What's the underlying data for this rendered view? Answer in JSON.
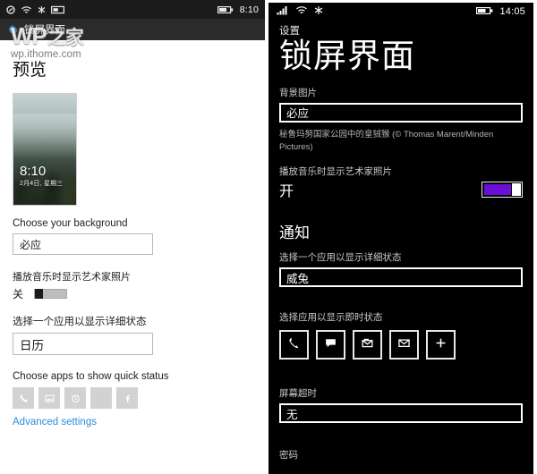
{
  "left": {
    "statusbar": {
      "icons": [
        "signal-icon",
        "wifi-icon",
        "bluetooth-icon",
        "sim-icon"
      ],
      "battery_icon": "battery-icon",
      "time": "8:10"
    },
    "appbar": {
      "gear_icon": "gear-icon",
      "title": "锁屏界面"
    },
    "watermark": {
      "big": "WP",
      "big_cn": "之家",
      "sub": "wp.ithome.com"
    },
    "preview_heading": "预览",
    "thumbnail": {
      "time": "8:10",
      "date": "2月4日, 星期三"
    },
    "background_label": "Choose your background",
    "background_value": "必应",
    "artist_label": "播放音乐时显示艺术家照片",
    "artist_state": "关",
    "detailed_status_label": "选择一个应用以显示详细状态",
    "detailed_status_value": "日历",
    "quick_status_label": "Choose apps to show quick status",
    "quick_tiles": [
      "phone-icon",
      "photo-icon",
      "alarm-icon",
      "empty-icon",
      "facebook-icon"
    ],
    "advanced_link": "Advanced settings"
  },
  "right": {
    "statusbar": {
      "icons": [
        "signal-icon",
        "wifi-icon",
        "bluetooth-icon"
      ],
      "battery_icon": "battery-icon",
      "time": "14:05"
    },
    "settings_label": "设置",
    "page_title": "锁屏界面",
    "background_label": "背景图片",
    "background_value": "必应",
    "background_caption": "秘鲁玛努国家公园中的皇狨猴 (© Thomas Marent/Minden Pictures)",
    "artist_label": "播放音乐时显示艺术家照片",
    "artist_state": "开",
    "notifications_heading": "通知",
    "detailed_status_label": "选择一个应用以显示详细状态",
    "detailed_status_value": "威兔",
    "quick_status_label": "选择应用以显示即时状态",
    "quick_tiles": [
      "phone-icon",
      "message-icon",
      "mail-open-icon",
      "mail-icon",
      "plus-icon"
    ],
    "timeout_label": "屏幕超时",
    "timeout_value": "无",
    "password_label": "密码",
    "accent_color": "#6a0fd8"
  }
}
